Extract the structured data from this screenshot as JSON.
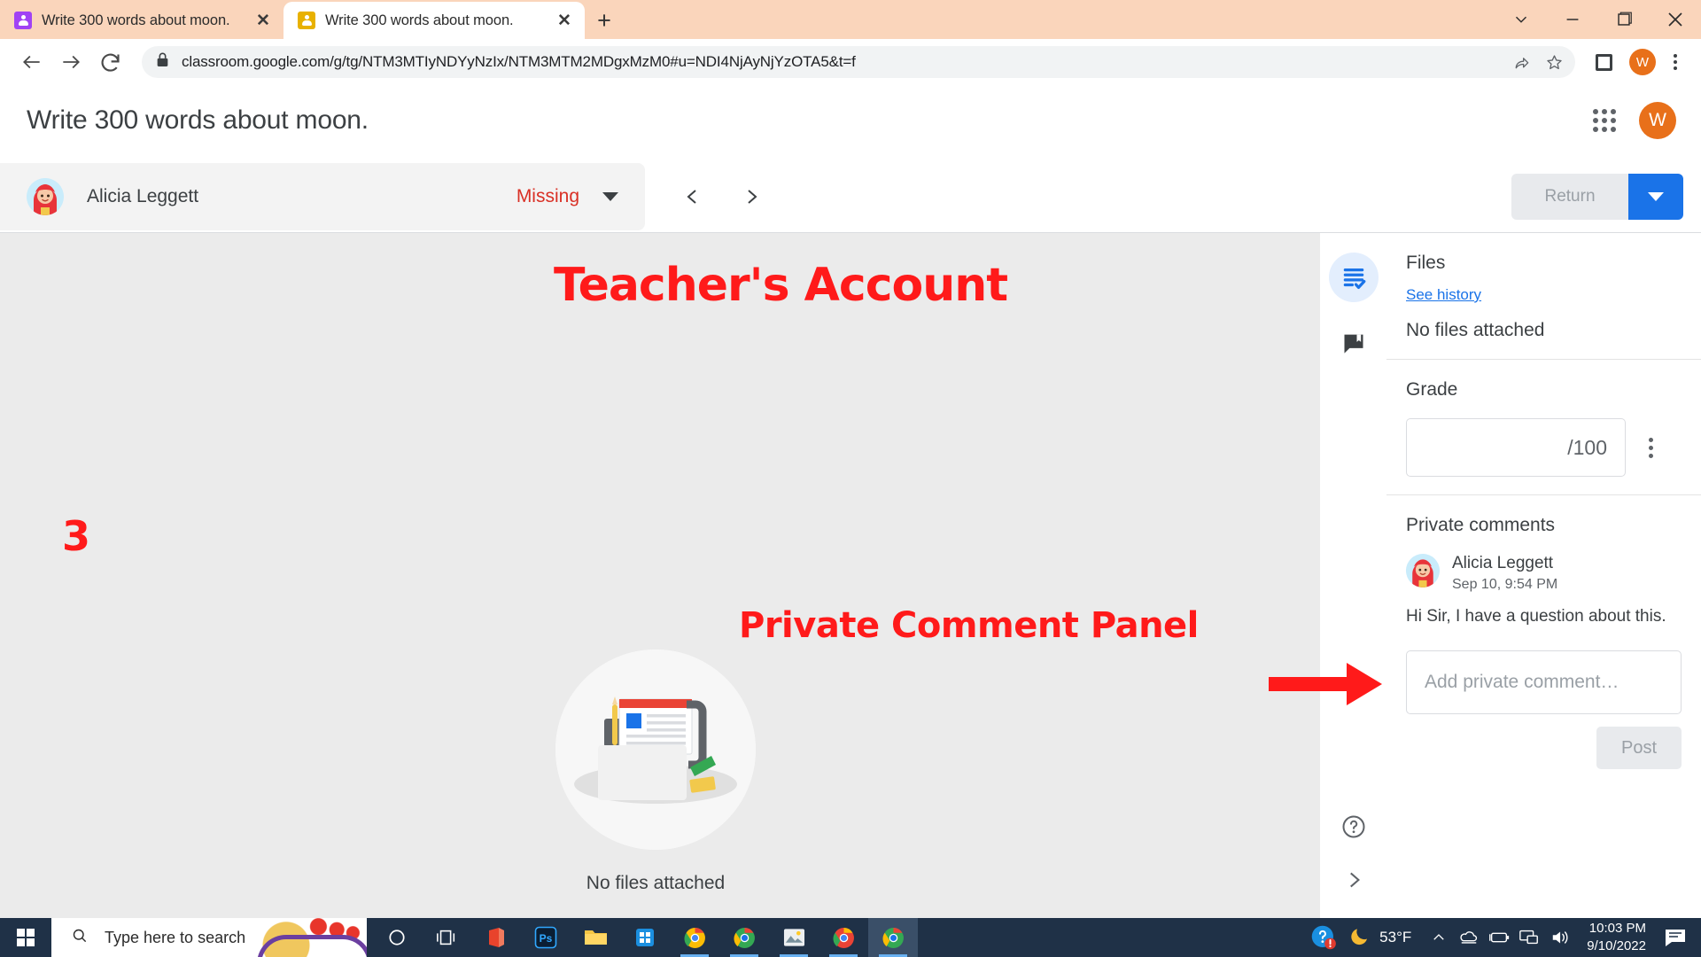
{
  "browser": {
    "tabs": [
      {
        "title": "Write 300 words about moon.",
        "favicon": "classroom-purple-icon",
        "active": false
      },
      {
        "title": "Write 300 words about moon.",
        "favicon": "classroom-yellow-icon",
        "active": true
      }
    ],
    "new_tab_label": "+",
    "close_label": "✕",
    "url": "classroom.google.com/g/tg/NTM3MTIyNDYyNzIx/NTM3MTM2MDgxMzM0#u=NDI4NjAyNjYzOTA5&t=f",
    "profile_initial": "W",
    "window_controls": {
      "minimize": "─",
      "maximize": "❐",
      "close": "✕",
      "more": "⌄"
    }
  },
  "classroom": {
    "page_title": "Write 300 words about moon.",
    "account_initial": "W",
    "student": {
      "name": "Alicia Leggett",
      "status": "Missing"
    },
    "return_button": "Return",
    "files": {
      "heading": "Files",
      "see_history": "See history",
      "empty_text": "No files attached"
    },
    "main_empty_caption": "No files attached",
    "grade": {
      "heading": "Grade",
      "value": "",
      "max_label": "/100"
    },
    "private_comments": {
      "heading": "Private comments",
      "comments": [
        {
          "author": "Alicia Leggett",
          "time": "Sep 10, 9:54 PM",
          "text": "Hi Sir, I have a question about this."
        }
      ],
      "input_placeholder": "Add private comment…",
      "post_label": "Post"
    }
  },
  "annotations": {
    "color": "#ff1a1a",
    "teacher_account": "Teacher's Account",
    "step_number": "3",
    "private_comment_panel": "Private Comment Panel"
  },
  "taskbar": {
    "search_placeholder": "Type here to search",
    "temperature": "53°F",
    "time": "10:03 PM",
    "date": "9/10/2022"
  }
}
